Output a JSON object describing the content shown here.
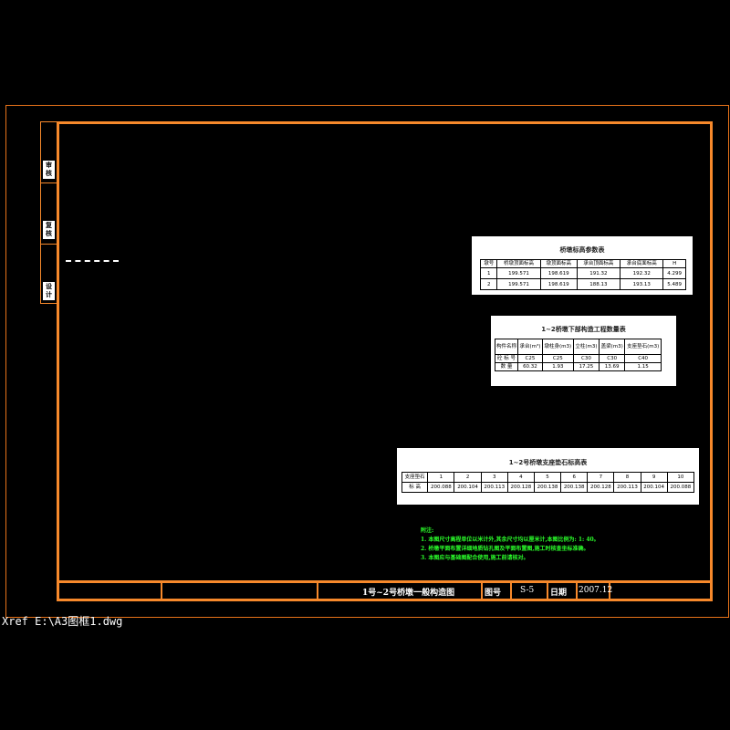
{
  "side_labels": [
    "审核",
    "复核",
    "设计"
  ],
  "title_block": {
    "drawing_title": "1号~2号桥墩一般构造图",
    "drawing_no_label": "图号",
    "drawing_no": "S-5",
    "date_label": "日期",
    "date": "2007.12"
  },
  "xref": "Xref E:\\A3图框1.dwg",
  "table1": {
    "title": "桥墩标高参数表",
    "headers": [
      "墩号",
      "桥墩顶面标高",
      "墩顶面标高",
      "承台顶面标高",
      "承台底面标高",
      "H"
    ],
    "rows": [
      [
        "1",
        "199.571",
        "198.619",
        "191.32",
        "192.32",
        "4.299"
      ],
      [
        "2",
        "199.571",
        "198.619",
        "188.13",
        "193.13",
        "5.489"
      ]
    ]
  },
  "table2": {
    "title": "1~2桥墩下部构造工程数量表",
    "headers": [
      "构件名称",
      "承台(m³)",
      "墩柱身(m3)",
      "立柱(m3)",
      "盖梁(m3)",
      "支座垫石(m3)"
    ],
    "rows": [
      [
        "砼 标 号",
        "C25",
        "C25",
        "C30",
        "C30",
        "C40"
      ],
      [
        "数 量",
        "60.32",
        "1.93",
        "17.25",
        "13.69",
        "1.15"
      ]
    ]
  },
  "table3": {
    "title": "1~2号桥墩支座垫石标高表",
    "headers": [
      "支座垫石",
      "1",
      "2",
      "3",
      "4",
      "5",
      "6",
      "7",
      "8",
      "9",
      "10"
    ],
    "rows": [
      [
        "标 高",
        "200.088",
        "200.104",
        "200.113",
        "200.128",
        "200.138",
        "200.138",
        "200.128",
        "200.113",
        "200.104",
        "200.088"
      ]
    ]
  },
  "notes": [
    "附注:",
    "1. 本图尺寸高程单位以米计外,其余尺寸均以厘米计,本图比例为: 1: 40。",
    "2. 桥墩平面布置详细地质钻孔图及平面布置图,施工时核查坐标准确。",
    "3. 本图应与基础图配合使用,施工前请核对。"
  ],
  "colors": {
    "frame": "#f7892b",
    "notes": "#2aff2a",
    "background": "#000000"
  }
}
